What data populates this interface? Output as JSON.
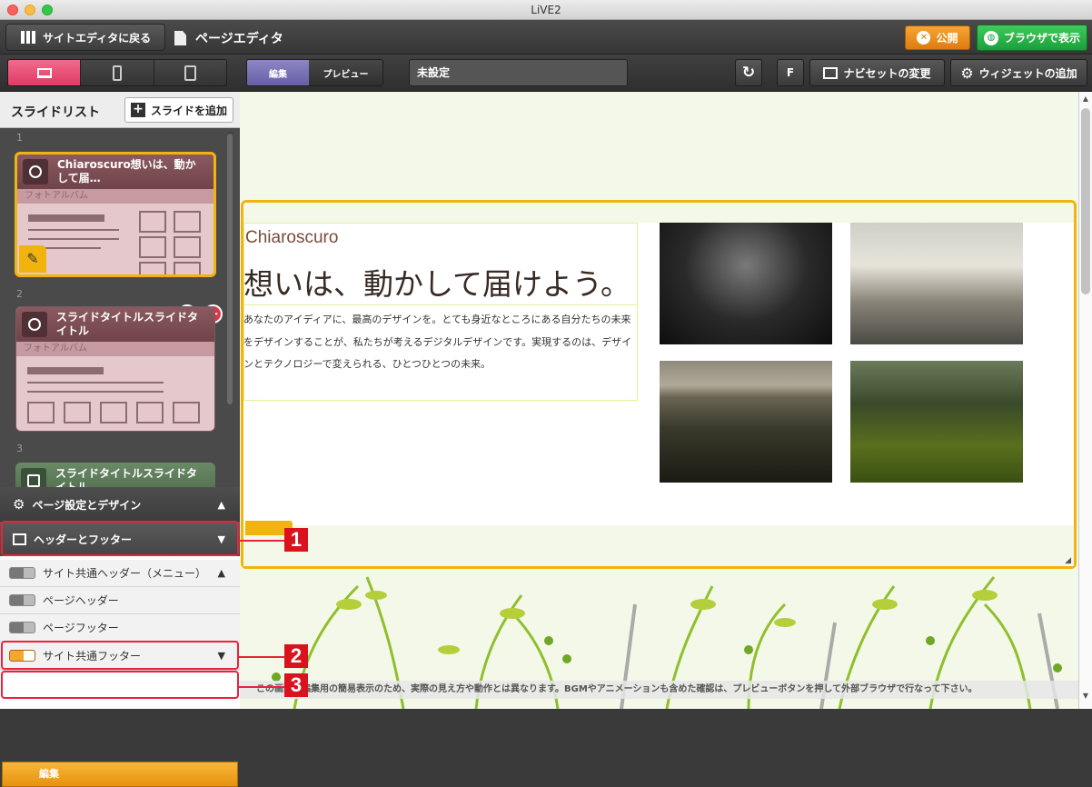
{
  "window": {
    "title": "LiVE2"
  },
  "header": {
    "back_label": "サイトエディタに戻る",
    "page_title": "ページエディタ",
    "publish_label": "公開",
    "browser_label": "ブラウザで表示"
  },
  "toolbar": {
    "mode_edit": "編集",
    "mode_preview": "プレビュー",
    "page_select": "未設定",
    "f_label": "F",
    "navset_label": "ナビセットの変更",
    "widget_label": "ウィジェットの追加"
  },
  "sidebar": {
    "title": "スライドリスト",
    "add_label": "スライドを追加",
    "slides": [
      {
        "num": "1",
        "title": "Chiaroscuro想いは、動かして届…",
        "type": "フォトアルバム"
      },
      {
        "num": "2",
        "title": "スライドタイトルスライドタイトル",
        "type": "フォトアルバム"
      },
      {
        "num": "3",
        "title": "スライドタイトルスライドタイトル"
      }
    ]
  },
  "panel": {
    "page_settings": "ページ設定とデザイン",
    "header_footer": "ヘッダーとフッター",
    "items": [
      "サイト共通ヘッダー（メニュー）",
      "ページヘッダー",
      "ページフッター",
      "サイト共通フッター"
    ],
    "edit_label": "編集"
  },
  "markers": [
    "1",
    "2",
    "3"
  ],
  "content": {
    "brand": "Chiaroscuro",
    "headline": "想いは、動かして届けよう。",
    "body": "あなたのアイディアに、最高のデザインを。とても身近なところにある自分たちの未来をデザインすることが、私たちが考えるデジタルデザインです。実現するのは、デザインとテクノロジーで変えられる、ひとつひとつの未来。"
  },
  "status": "この画面は編集用の簡易表示のため、実際の見え方や動作とは異なります。BGMやアニメーションも含めた確認は、プレビューボタンを押して外部ブラウザで行なって下さい。",
  "colors": {
    "accent_pink": "#e03a66",
    "accent_orange": "#f1b40e",
    "publish_orange": "#df7b10",
    "browser_green": "#1aa03a",
    "marker_red": "#d9131e",
    "edit_purple": "#675fa6"
  }
}
